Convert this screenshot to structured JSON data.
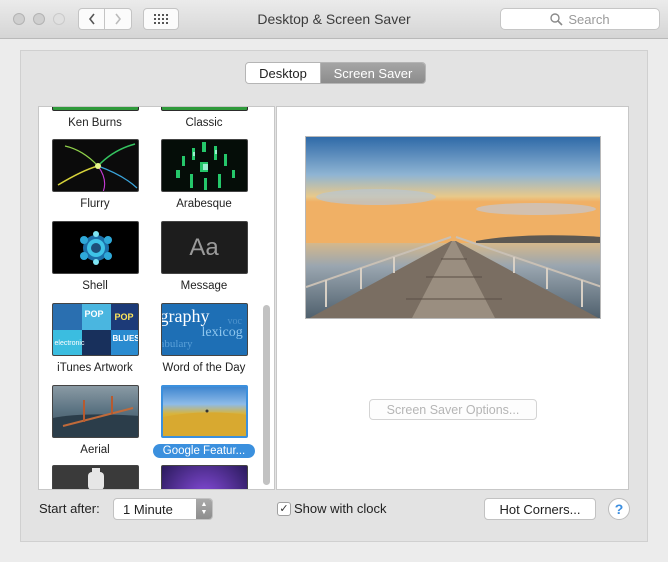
{
  "window": {
    "title": "Desktop & Screen Saver"
  },
  "search": {
    "placeholder": "Search"
  },
  "tabs": {
    "desktop": "Desktop",
    "screen_saver": "Screen Saver"
  },
  "savers": [
    {
      "label": "Ken Burns"
    },
    {
      "label": "Classic"
    },
    {
      "label": "Flurry"
    },
    {
      "label": "Arabesque"
    },
    {
      "label": "Shell"
    },
    {
      "label": "Message"
    },
    {
      "label": "iTunes Artwork"
    },
    {
      "label": "Word of the Day"
    },
    {
      "label": "Aerial"
    },
    {
      "label": "Google Featur..."
    }
  ],
  "thumb_text": {
    "message": "Aa",
    "wotd_1": "graphy",
    "wotd_2": "lexicog",
    "wotd_3": "abulary",
    "wotd_4": "voc",
    "itunes_1": "POP",
    "itunes_2": "BLUES",
    "itunes_3": "POP",
    "itunes_4": "electronic"
  },
  "options_button": "Screen Saver Options...",
  "start_after": {
    "label": "Start after:",
    "value": "1 Minute"
  },
  "show_clock": {
    "label": "Show with clock",
    "checked": true,
    "mark": "✓"
  },
  "hot_corners": "Hot Corners...",
  "help": "?",
  "colors": {
    "selection": "#3b90de",
    "help_blue": "#3b8ee0"
  }
}
